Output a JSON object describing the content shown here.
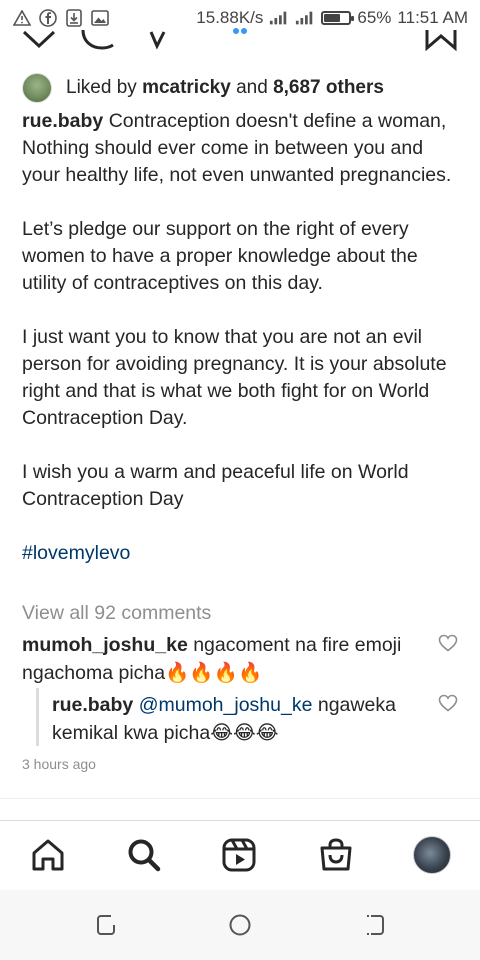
{
  "status_bar": {
    "network_speed": "15.88K/s",
    "battery_percent": "65%",
    "battery_level": 0.65,
    "time": "11:51 AM",
    "left_icons": [
      "alert-icon",
      "facebook-icon",
      "download-icon",
      "image-icon"
    ]
  },
  "post": {
    "likes": {
      "prefix": "Liked by ",
      "user": "mcatricky",
      "middle": " and ",
      "others": "8,687 others"
    },
    "caption": {
      "username": "rue.baby",
      "paragraph1": " Contraception doesn't define a woman, Nothing should ever come in between you and your healthy life, not even unwanted pregnancies.",
      "paragraph2": "Let’s pledge our support on the right of every women to have a proper knowledge about the utility of contraceptives on this day.",
      "paragraph3": "I just want you to know that you are not an evil person for avoiding pregnancy. It is your absolute right and that is what we both fight for on World Contraception Day.",
      "paragraph4": "I wish you a warm and peaceful life on World Contraception Day",
      "hashtag": "#lovemylevo"
    },
    "view_all_comments": "View all 92 comments",
    "comments": [
      {
        "username": "mumoh_joshu_ke",
        "text": " ngacoment na fire emoji ngachoma picha🔥🔥🔥🔥"
      }
    ],
    "reply": {
      "username": "rue.baby",
      "mention": "@mumoh_joshu_ke",
      "text": " ngaweka kemikal kwa picha😂😂😂"
    },
    "timestamp": "3 hours ago"
  },
  "bottom_nav": [
    "home-icon",
    "search-icon",
    "reels-icon",
    "shop-icon",
    "profile-avatar"
  ],
  "colors": {
    "text": "#262626",
    "secondary": "#8e8e8e",
    "link": "#00376b",
    "divider": "#dbdbdb"
  }
}
